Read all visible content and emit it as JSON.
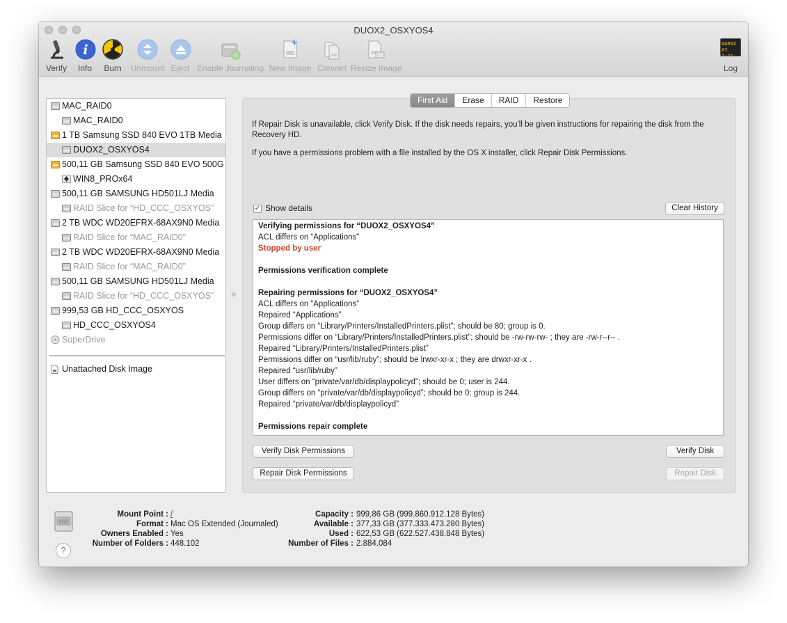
{
  "window": {
    "title": "DUOX2_OSXYOS4"
  },
  "toolbar": {
    "verify": "Verify",
    "info": "Info",
    "burn": "Burn",
    "unmount": "Unmount",
    "eject": "Eject",
    "enable_journaling": "Enable Journaling",
    "new_image": "New Image",
    "convert": "Convert",
    "resize_image": "Resize Image",
    "log": "Log",
    "log_icon_text": "WARNI",
    "log_icon_text2": "AY 7:36"
  },
  "sidebar": {
    "items": [
      {
        "label": "MAC_RAID0",
        "icon": "hard-drive-icon"
      },
      {
        "label": "MAC_RAID0",
        "icon": "volume-icon"
      },
      {
        "label": "1 TB Samsung SSD 840 EVO 1TB Media",
        "icon": "external-drive-icon"
      },
      {
        "label": "DUOX2_OSXYOS4",
        "icon": "volume-icon"
      },
      {
        "label": "500,11 GB Samsung SSD 840 EVO 500G",
        "icon": "external-drive-icon"
      },
      {
        "label": "WIN8_PROx64",
        "icon": "windows-volume-icon"
      },
      {
        "label": "500,11 GB SAMSUNG HD501LJ Media",
        "icon": "hard-drive-icon"
      },
      {
        "label": "RAID Slice for “HD_CCC_OSXYOS”",
        "icon": "raid-slice-icon"
      },
      {
        "label": "2 TB WDC WD20EFRX-68AX9N0 Media",
        "icon": "hard-drive-icon"
      },
      {
        "label": "RAID Slice for “MAC_RAID0”",
        "icon": "raid-slice-icon"
      },
      {
        "label": "2 TB WDC WD20EFRX-68AX9N0 Media",
        "icon": "hard-drive-icon"
      },
      {
        "label": "RAID Slice for “MAC_RAID0”",
        "icon": "raid-slice-icon"
      },
      {
        "label": "500,11 GB SAMSUNG HD501LJ Media",
        "icon": "hard-drive-icon"
      },
      {
        "label": "RAID Slice for “HD_CCC_OSXYOS”",
        "icon": "raid-slice-icon"
      },
      {
        "label": "999,53 GB HD_CCC_OSXYOS",
        "icon": "hard-drive-icon"
      },
      {
        "label": "HD_CCC_OSXYOS4",
        "icon": "volume-icon"
      },
      {
        "label": "SuperDrive",
        "icon": "optical-drive-icon"
      }
    ],
    "unattached": "Unattached Disk Image"
  },
  "tabs": [
    "First Aid",
    "Erase",
    "RAID",
    "Restore"
  ],
  "first_aid": {
    "help_1": "If Repair Disk is unavailable, click Verify Disk. If the disk needs repairs, you'll be given instructions for repairing the disk from the Recovery HD.",
    "help_2": "If you have a permissions problem with a file installed by the OS X installer, click Repair Disk Permissions.",
    "show_details": "Show details",
    "show_details_checked": true,
    "clear_history": "Clear History",
    "log_lines": [
      {
        "text": "Verifying permissions for “DUOX2_OSXYOS4”",
        "style": "bold"
      },
      {
        "text": "ACL differs on “Applications”",
        "style": "normal"
      },
      {
        "text": "Stopped by user",
        "style": "red"
      },
      {
        "text": "",
        "style": "normal"
      },
      {
        "text": "Permissions verification complete",
        "style": "bold"
      },
      {
        "text": "",
        "style": "normal"
      },
      {
        "text": "Repairing permissions for “DUOX2_OSXYOS4”",
        "style": "bold"
      },
      {
        "text": "ACL differs on “Applications”",
        "style": "normal"
      },
      {
        "text": "Repaired “Applications”",
        "style": "normal"
      },
      {
        "text": "Group differs on “Library/Printers/InstalledPrinters.plist”; should be 80; group is 0.",
        "style": "normal"
      },
      {
        "text": "Permissions differ on “Library/Printers/InstalledPrinters.plist”; should be -rw-rw-rw- ; they are -rw-r--r-- .",
        "style": "normal"
      },
      {
        "text": "Repaired “Library/Printers/InstalledPrinters.plist”",
        "style": "normal"
      },
      {
        "text": "Permissions differ on “usr/lib/ruby”; should be lrwxr-xr-x ; they are drwxr-xr-x .",
        "style": "normal"
      },
      {
        "text": "Repaired “usr/lib/ruby”",
        "style": "normal"
      },
      {
        "text": "User differs on “private/var/db/displaypolicyd”; should be 0; user is 244.",
        "style": "normal"
      },
      {
        "text": "Group differs on “private/var/db/displaypolicyd”; should be 0; group is 244.",
        "style": "normal"
      },
      {
        "text": "Repaired “private/var/db/displaypolicyd”",
        "style": "normal"
      },
      {
        "text": "",
        "style": "normal"
      },
      {
        "text": "Permissions repair complete",
        "style": "bold"
      }
    ],
    "verify_permissions": "Verify Disk Permissions",
    "repair_permissions": "Repair Disk Permissions",
    "verify_disk": "Verify Disk",
    "repair_disk": "Repair Disk"
  },
  "info": {
    "mount_point_label": "Mount Point :",
    "mount_point": "/",
    "format_label": "Format :",
    "format": "Mac OS Extended (Journaled)",
    "owners_label": "Owners Enabled :",
    "owners": "Yes",
    "folders_label": "Number of Folders :",
    "folders": "448.102",
    "capacity_label": "Capacity :",
    "capacity": "999,86 GB (999.860.912.128 Bytes)",
    "available_label": "Available :",
    "available": "377,33 GB (377.333.473.280 Bytes)",
    "used_label": "Used :",
    "used": "622,53 GB (622.527.438.848 Bytes)",
    "files_label": "Number of Files :",
    "files": "2.884.084",
    "disk_icon_text": "SSD",
    "help": "?"
  }
}
